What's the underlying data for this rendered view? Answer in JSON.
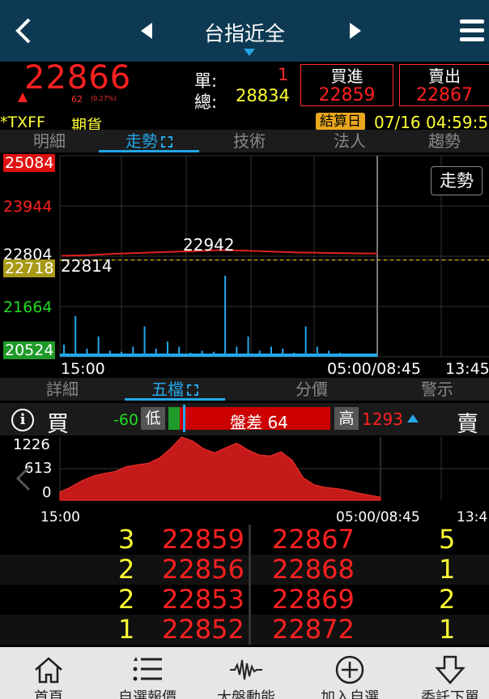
{
  "header": {
    "back_icon": "chevron-left-icon",
    "prev_icon": "triangle-left-icon",
    "next_icon": "triangle-right-icon",
    "title": "台指近全",
    "menu_icon": "hamburger-icon"
  },
  "quote": {
    "price": "22866",
    "change": "62",
    "change_pct": "(0.27%)",
    "unit_label": "單:",
    "unit_value": "1",
    "total_label": "總:",
    "total_value": "28834",
    "buy_label": "買進",
    "buy_price": "22859",
    "sell_label": "賣出",
    "sell_price": "22867",
    "symbol": "*TXFF",
    "market": "期貨",
    "settle_label": "結算日",
    "settle_time": "07/16 04:59:5"
  },
  "tabs_top": [
    "明細",
    "走勢",
    "技術",
    "法人",
    "趨勢"
  ],
  "chart_data": [
    {
      "type": "line",
      "title": "",
      "y_labels": [
        "25084",
        "23944",
        "22804",
        "22718",
        "21664",
        "20524"
      ],
      "ylim": [
        20524,
        25084
      ],
      "reference_price": 22804,
      "last_price": 22718,
      "annotations": [
        {
          "text": "22942"
        },
        {
          "text": "22814"
        }
      ],
      "x_labels": [
        "15:00",
        "05:00/08:45",
        "13:45"
      ],
      "series": [
        {
          "values": [
            22814,
            22830,
            22860,
            22880,
            22900,
            22920,
            22942,
            22930,
            22910,
            22890,
            22880,
            22870,
            22866
          ]
        }
      ],
      "volume_description": "volume bars spiking near 15:00, 22:00 and 00:30",
      "volume": [
        12,
        40,
        8,
        20,
        6,
        5,
        10,
        30,
        8,
        15,
        10,
        4,
        6,
        5,
        80,
        10,
        20,
        6,
        10,
        8,
        4,
        30,
        10,
        6,
        4,
        3,
        2,
        2
      ]
    },
    {
      "type": "area",
      "y_labels": [
        "1226",
        "613",
        "0"
      ],
      "ylim": [
        0,
        1226
      ],
      "x_labels": [
        "15:00",
        "05:00/08:45",
        "13:4"
      ],
      "values": [
        160,
        260,
        380,
        470,
        520,
        560,
        650,
        690,
        720,
        820,
        1000,
        1226,
        1150,
        1000,
        920,
        1020,
        1110,
        980,
        880,
        860,
        940,
        780,
        440,
        300,
        250,
        230,
        190,
        140,
        100,
        60
      ]
    }
  ],
  "trend_button": "走勢",
  "tabs_mid": [
    "詳細",
    "五檔",
    "分價",
    "警示"
  ],
  "five_level": {
    "info_icon": "info-icon",
    "buy_label": "買",
    "sell_label": "賣",
    "diff_neg": "-60",
    "low_label": "低",
    "gap_text": "盤差 64",
    "high_label": "高",
    "diff_pos": "1293"
  },
  "order_book": [
    {
      "bid_qty": "3",
      "bid_price": "22859",
      "ask_price": "22867",
      "ask_qty": "5"
    },
    {
      "bid_qty": "2",
      "bid_price": "22856",
      "ask_price": "22868",
      "ask_qty": "1"
    },
    {
      "bid_qty": "2",
      "bid_price": "22853",
      "ask_price": "22869",
      "ask_qty": "2"
    },
    {
      "bid_qty": "1",
      "bid_price": "22852",
      "ask_price": "22872",
      "ask_qty": "1"
    }
  ],
  "bottom_nav": [
    {
      "label": "首頁",
      "icon": "home-icon"
    },
    {
      "label": "自選報價",
      "icon": "list-icon"
    },
    {
      "label": "大盤動能",
      "icon": "pulse-icon"
    },
    {
      "label": "加入自選",
      "icon": "plus-circle-icon"
    },
    {
      "label": "委託下單",
      "icon": "download-arrow-icon"
    }
  ]
}
